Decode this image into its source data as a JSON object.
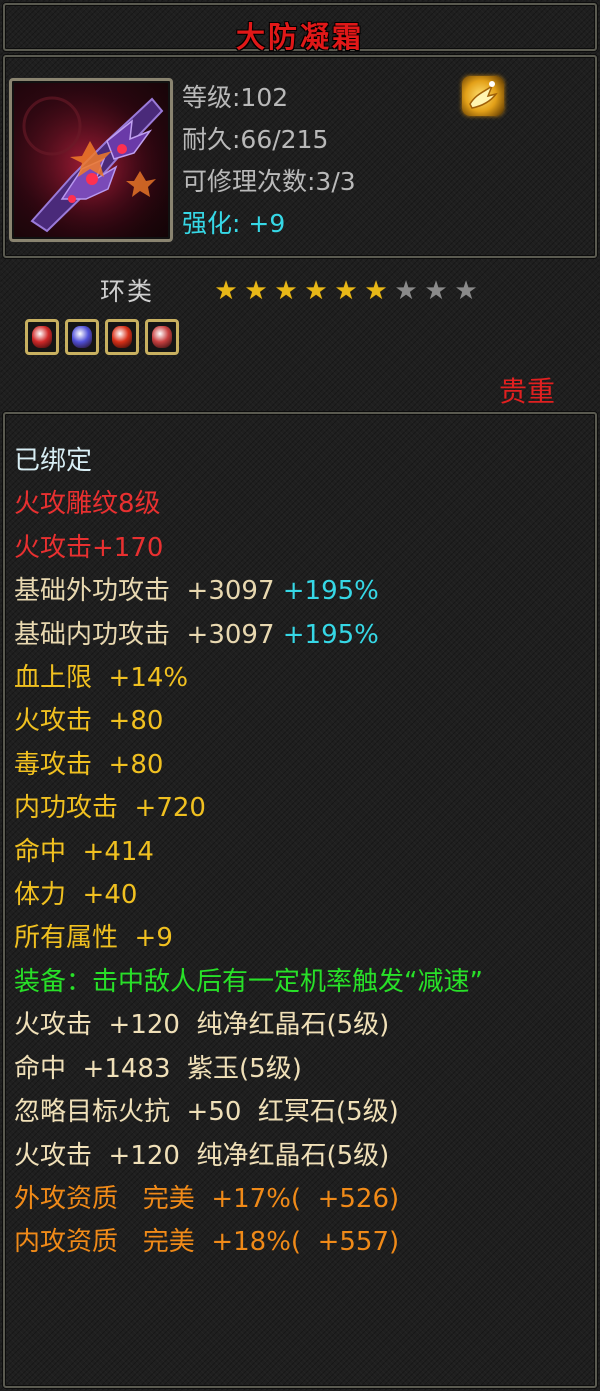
{
  "item": {
    "name": "大防凝霜",
    "level": "等级:102",
    "durability": "耐久:66/215",
    "repairs": "可修理次数:3/3",
    "enhance_label": "强化:",
    "enhance_value": "+9",
    "type": "环类",
    "stars": {
      "filled": 6,
      "total": 9
    },
    "gems": [
      {
        "name": "green-gem-icon",
        "color": "#d02828"
      },
      {
        "name": "purple-gem-icon",
        "color": "#5050d8"
      },
      {
        "name": "red-gem-icon",
        "color": "#d83018"
      },
      {
        "name": "green-gem-icon",
        "color": "#c84040"
      }
    ],
    "rarity": "贵重"
  },
  "attributes": [
    {
      "segments": [
        {
          "text": "已绑定",
          "color": "#d8eef4"
        }
      ]
    },
    {
      "segments": [
        {
          "text": "火攻雕纹8级",
          "color": "#e83030"
        }
      ]
    },
    {
      "segments": [
        {
          "text": "火攻击+170",
          "color": "#e83030"
        }
      ]
    },
    {
      "segments": [
        {
          "text": "基础外功攻击  +3097 ",
          "color": "#e8d8b0"
        },
        {
          "text": "+195%",
          "color": "#36d8e6"
        }
      ]
    },
    {
      "segments": [
        {
          "text": "基础内功攻击  +3097 ",
          "color": "#e8d8b0"
        },
        {
          "text": "+195%",
          "color": "#36d8e6"
        }
      ]
    },
    {
      "segments": [
        {
          "text": "血上限  +14%",
          "color": "#f0c020"
        }
      ]
    },
    {
      "segments": [
        {
          "text": "火攻击  +80",
          "color": "#f0c020"
        }
      ]
    },
    {
      "segments": [
        {
          "text": "毒攻击  +80",
          "color": "#f0c020"
        }
      ]
    },
    {
      "segments": [
        {
          "text": "内功攻击  +720",
          "color": "#f0c020"
        }
      ]
    },
    {
      "segments": [
        {
          "text": "命中  +414",
          "color": "#f0c020"
        }
      ]
    },
    {
      "segments": [
        {
          "text": "体力  +40",
          "color": "#f0c020"
        }
      ]
    },
    {
      "segments": [
        {
          "text": "所有属性  +9",
          "color": "#f0c020"
        }
      ]
    },
    {
      "segments": [
        {
          "text": "装备：击中敌人后有一定机率触发“减速”",
          "color": "#28e028"
        }
      ],
      "wrap": true
    },
    {
      "segments": [
        {
          "text": "火攻击  +120  纯净红晶石(5级)",
          "color": "#f0e0b8"
        }
      ]
    },
    {
      "segments": [
        {
          "text": "命中  +1483  紫玉(5级)",
          "color": "#f0e0b8"
        }
      ]
    },
    {
      "segments": [
        {
          "text": "忽略目标火抗  +50  红冥石(5级)",
          "color": "#f0e0b8"
        }
      ]
    },
    {
      "segments": [
        {
          "text": "火攻击  +120  纯净红晶石(5级)",
          "color": "#f0e0b8"
        }
      ]
    },
    {
      "segments": [
        {
          "text": "外攻资质   完美  +17%(  +526)",
          "color": "#f08a18"
        }
      ]
    },
    {
      "segments": [
        {
          "text": "内攻资质   完美  +18%(  +557)",
          "color": "#f08a18"
        }
      ]
    }
  ]
}
